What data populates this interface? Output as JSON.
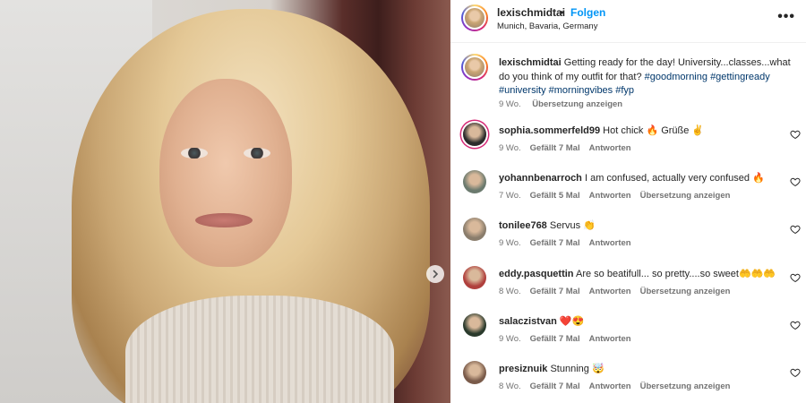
{
  "post": {
    "username": "lexischmidtai",
    "follow_label": "Folgen",
    "separator": "•",
    "location": "Munich, Bavaria, Germany",
    "more_label": "•••",
    "caption": {
      "username": "lexischmidtai",
      "text": "Getting ready for the day! University...classes...what do you think of my outfit for that?",
      "hashtags": [
        "#goodmorning",
        "#gettingready",
        "#university",
        "#morningvibes",
        "#fyp"
      ],
      "age": "9 Wo.",
      "translate_label": "Übersetzung anzeigen"
    }
  },
  "comments": [
    {
      "username": "sophia.sommerfeld99",
      "text": "Hot chick 🔥 Grüße ✌",
      "age": "9 Wo.",
      "likes": "Gefällt 7 Mal",
      "reply": "Antworten",
      "translate": "",
      "avatar_color": "#2b2b2b",
      "story": true
    },
    {
      "username": "yohannbenarroch",
      "text": "I am confused, actually very confused 🔥",
      "age": "7 Wo.",
      "likes": "Gefällt 5 Mal",
      "reply": "Antworten",
      "translate": "Übersetzung anzeigen",
      "avatar_color": "#6b7a6e",
      "story": false
    },
    {
      "username": "tonilee768",
      "text": "Servus 👏",
      "age": "9 Wo.",
      "likes": "Gefällt 7 Mal",
      "reply": "Antworten",
      "translate": "",
      "avatar_color": "#8a7d6c",
      "story": false
    },
    {
      "username": "eddy.pasquettin",
      "text": "Are so beatifull... so pretty....so sweet🤲🤲🤲",
      "age": "8 Wo.",
      "likes": "Gefällt 7 Mal",
      "reply": "Antworten",
      "translate": "Übersetzung anzeigen",
      "avatar_color": "#b0403d",
      "story": false
    },
    {
      "username": "salaczistvan",
      "text": "❤️😍",
      "age": "9 Wo.",
      "likes": "Gefällt 7 Mal",
      "reply": "Antworten",
      "translate": "",
      "avatar_color": "#2a3a2c",
      "story": false
    },
    {
      "username": "presiznuik",
      "text": "Stunning 🤯",
      "age": "8 Wo.",
      "likes": "Gefällt 7 Mal",
      "reply": "Antworten",
      "translate": "Übersetzung anzeigen",
      "avatar_color": "#7a5b4a",
      "story": false
    }
  ],
  "icons": {
    "heart": "heart-outline-icon",
    "next": "chevron-right-icon",
    "more": "more-horizontal-icon"
  },
  "colors": {
    "follow": "#0095f6",
    "hashtag": "#00376b",
    "meta": "#737373"
  }
}
